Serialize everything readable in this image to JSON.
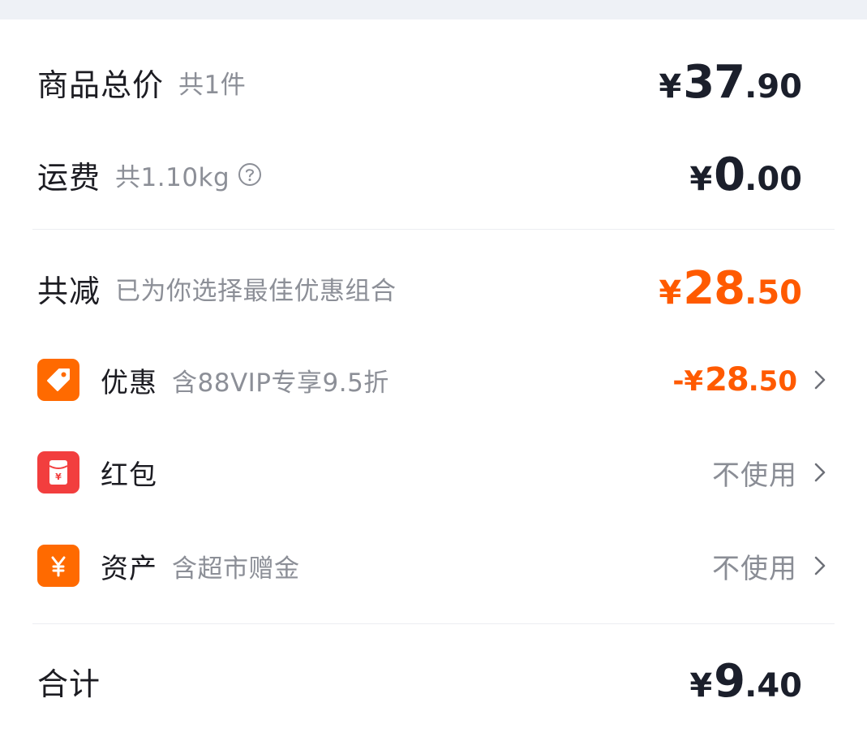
{
  "summary": {
    "goods_total": {
      "label": "商品总价",
      "sub": "共1件",
      "currency": "¥",
      "int": "37",
      "dec": ".90"
    },
    "shipping": {
      "label": "运费",
      "sub": "共1.10kg",
      "currency": "¥",
      "int": "0",
      "dec": ".00"
    },
    "discount_total": {
      "label": "共减",
      "sub": "已为你选择最佳优惠组合",
      "currency": "¥",
      "int": "28",
      "dec": ".50"
    }
  },
  "items": {
    "promo": {
      "label": "优惠",
      "sub": "含88VIP专享9.5折",
      "prefix": "-¥",
      "int": "28",
      "dec": ".50",
      "icon": "tag-icon"
    },
    "red_packet": {
      "label": "红包",
      "value": "不使用",
      "icon": "red-packet-icon"
    },
    "assets": {
      "label": "资产",
      "sub": "含超市赠金",
      "value": "不使用",
      "icon": "yen-icon"
    }
  },
  "total": {
    "label": "合计",
    "currency": "¥",
    "int": "9",
    "dec": ".40"
  },
  "colors": {
    "accent": "#ff5a00",
    "icon_orange": "#ff6a00",
    "icon_red": "#f23e3e"
  }
}
